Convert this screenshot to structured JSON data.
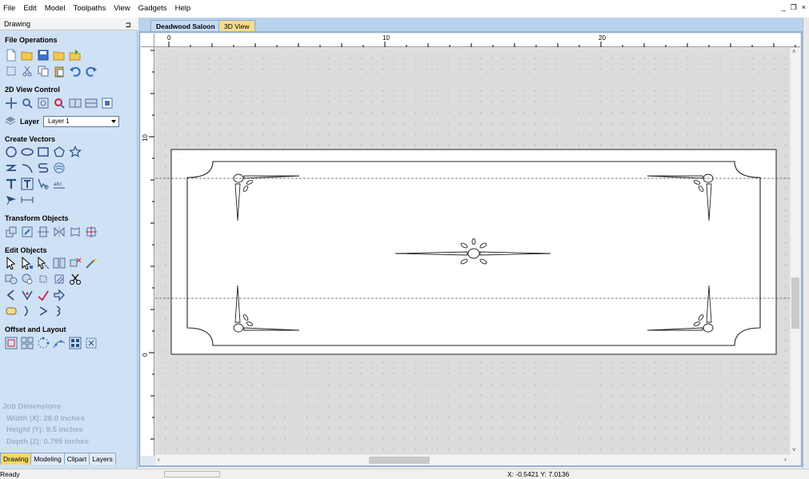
{
  "menu": [
    "File",
    "Edit",
    "Model",
    "Toolpaths",
    "View",
    "Gadgets",
    "Help"
  ],
  "window_controls": {
    "minimize": "_",
    "restore": "❐",
    "close": "×"
  },
  "panel": {
    "title": "Drawing",
    "sections": {
      "file_operations": "File Operations",
      "view_control": "2D View Control",
      "create_vectors": "Create Vectors",
      "transform_objects": "Transform Objects",
      "edit_objects": "Edit Objects",
      "offset_layout": "Offset and Layout"
    },
    "layer_label": "Layer",
    "layer_value": "Layer 1",
    "job_dimensions": {
      "title": "Job Dimensions",
      "width": "Width  |X|: 28.0 inches",
      "height": "Height |Y|: 9.5 inches",
      "depth": "Depth  |Z|: 0.795 inches"
    },
    "bottom_tabs": [
      "Drawing",
      "Modeling",
      "Clipart",
      "Layers"
    ]
  },
  "document_tabs": [
    "Deadwood Saloon",
    "3D View"
  ],
  "rulers": {
    "top": [
      "0",
      "10",
      "20"
    ],
    "left": [
      "10",
      "0"
    ]
  },
  "status": {
    "left": "Ready",
    "coords": "X: -0.5421 Y:  7.0136"
  },
  "colors": {
    "panel_bg": "#cfe1f5",
    "active_tab": "#f5d96a",
    "canvas_bg": "#dcdcdc"
  }
}
